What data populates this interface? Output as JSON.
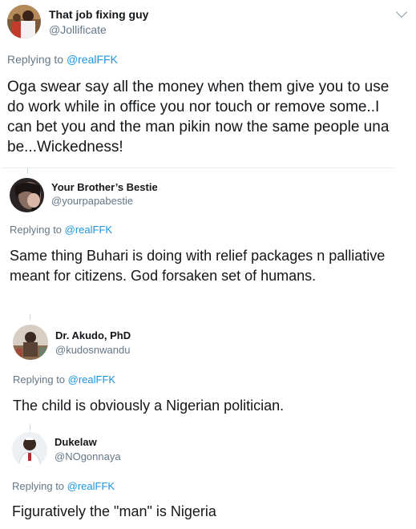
{
  "tweets": [
    {
      "display_name": "That job fixing guy",
      "handle": "@Jollificate",
      "replying_prefix": "Replying to ",
      "replying_to": "@realFFK",
      "text": "Oga swear say all the money when them give you to use do work while in office you nor touch or remove some..I can bet you and the man pikin now the same people una be...Wickedness!",
      "avatar_icon": "profile-photo"
    },
    {
      "display_name": "Your Brother’s Bestie",
      "handle": "@yourpapabestie",
      "replying_prefix": "Replying to ",
      "replying_to": "@realFFK",
      "text": "Same thing Buhari is doing with relief packages n palliative meant for citizens. God forsaken set of humans.",
      "avatar_icon": "profile-photo"
    },
    {
      "display_name": "Dr. Akudo, PhD",
      "handle": "@kudosnwandu",
      "replying_prefix": "Replying to ",
      "replying_to": "@realFFK",
      "text": "The child is obviously a Nigerian politician.",
      "avatar_icon": "profile-photo"
    },
    {
      "display_name": "Dukelaw",
      "handle": "@NOgonnaya",
      "replying_prefix": "Replying to ",
      "replying_to": "@realFFK",
      "text": "Figuratively the \"man\" is Nigeria",
      "avatar_icon": "profile-photo"
    }
  ],
  "colors": {
    "link": "#1b95e0",
    "secondary_text": "#657786",
    "primary_text": "#14171a",
    "divider": "#e6ecf0"
  },
  "icons": {
    "more": "chevron-down-icon"
  }
}
